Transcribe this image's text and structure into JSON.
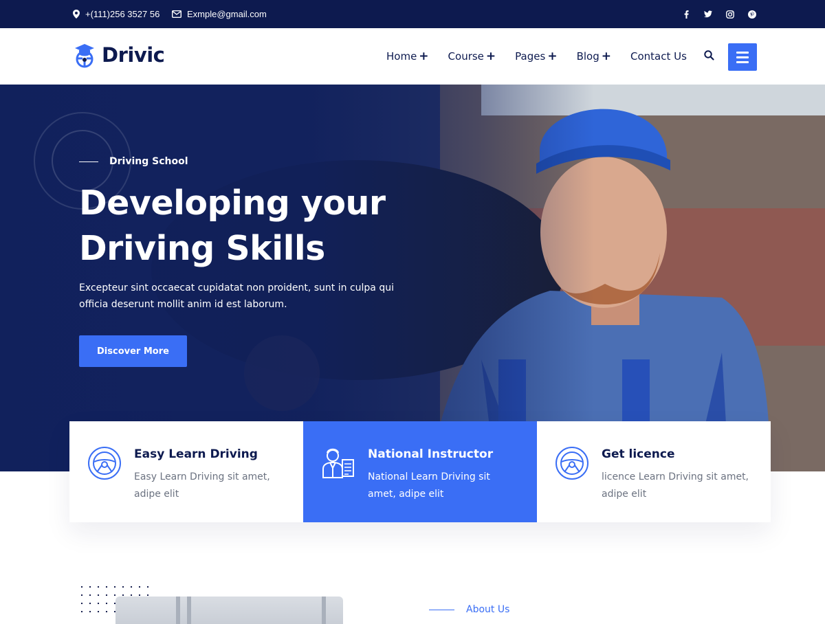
{
  "topbar": {
    "phone": "+(111)256 3527 56",
    "email": "Exmple@gmail.com",
    "socials": [
      "facebook-icon",
      "twitter-icon",
      "instagram-icon",
      "pinterest-icon"
    ]
  },
  "header": {
    "logo_text": "Drivic",
    "nav": [
      {
        "label": "Home",
        "has_submenu": true
      },
      {
        "label": "Course",
        "has_submenu": true
      },
      {
        "label": "Pages",
        "has_submenu": true
      },
      {
        "label": "Blog",
        "has_submenu": true
      },
      {
        "label": "Contact Us",
        "has_submenu": false
      }
    ],
    "plus": "+"
  },
  "hero": {
    "eyebrow": "Driving School",
    "title_line1": "Developing your",
    "title_line2": "Driving Skills",
    "text": "Excepteur sint occaecat cupidatat non proident, sunt in culpa qui officia deserunt mollit anim id est laborum.",
    "button_label": "Discover More"
  },
  "features": [
    {
      "title": "Easy Learn Driving",
      "desc": "Easy Learn Driving sit amet, adipe elit",
      "icon": "steering-wheel-icon",
      "active": false
    },
    {
      "title": "National Instructor",
      "desc": "National Learn Driving sit amet, adipe elit",
      "icon": "instructor-icon",
      "active": true
    },
    {
      "title": "Get licence",
      "desc": "licence Learn Driving sit amet, adipe elit",
      "icon": "steering-wheel-icon",
      "active": false
    }
  ],
  "about": {
    "label": "About Us"
  },
  "colors": {
    "navy": "#0d1a4f",
    "accent": "#3a6ef5"
  }
}
